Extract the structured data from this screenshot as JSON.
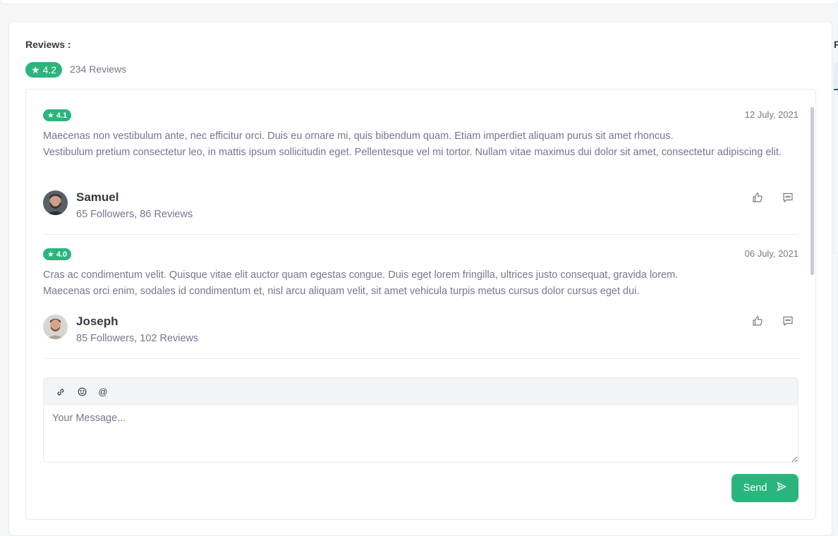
{
  "reviews": {
    "title": "Reviews :",
    "overall_rating": "4.2",
    "count_label": "234 Reviews",
    "items": [
      {
        "rating": "4.1",
        "date": "12 July, 2021",
        "paragraphs": [
          "Maecenas non vestibulum ante, nec efficitur orci. Duis eu ornare mi, quis bibendum quam. Etiam imperdiet aliquam purus sit amet rhoncus.",
          "Vestibulum pretium consectetur leo, in mattis ipsum sollicitudin eget. Pellentesque vel mi tortor. Nullam vitae maximus dui dolor sit amet, consectetur adipiscing elit."
        ],
        "author": "Samuel",
        "meta": "65 Followers, 86 Reviews"
      },
      {
        "rating": "4.0",
        "date": "06 July, 2021",
        "paragraphs": [
          "Cras ac condimentum velit. Quisque vitae elit auctor quam egestas congue. Duis eget lorem fringilla, ultrices justo consequat, gravida lorem.",
          "Maecenas orci enim, sodales id condimentum et, nisl arcu aliquam velit, sit amet vehicula turpis metus cursus dolor cursus eget dui."
        ],
        "author": "Joseph",
        "meta": "85 Followers, 102 Reviews"
      }
    ]
  },
  "composer": {
    "placeholder": "Your Message...",
    "tools": [
      "link-icon",
      "emoji-icon",
      "mention-icon"
    ],
    "send_label": "Send"
  },
  "side": {
    "title": "P"
  },
  "colors": {
    "accent": "#2ab57d",
    "text_muted": "#74788d",
    "heading": "#343a40"
  }
}
